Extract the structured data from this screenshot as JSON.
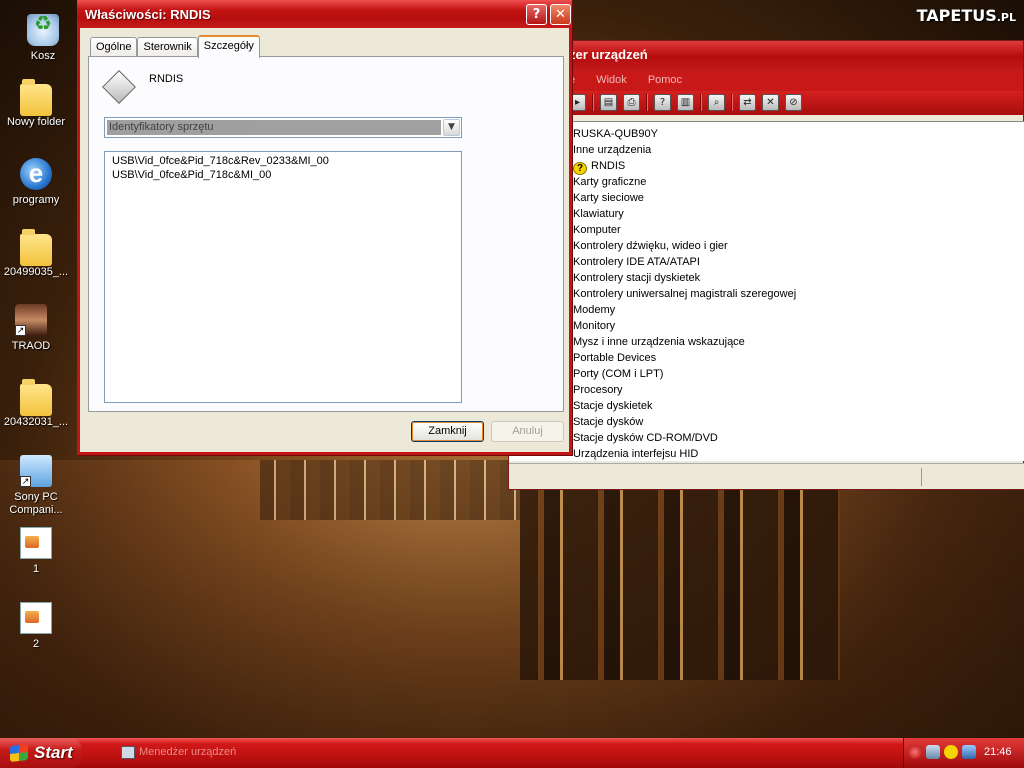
{
  "wallpaper": {
    "logo_main": "TAPETUS",
    "logo_suffix": ".PL"
  },
  "desktop_icons": [
    {
      "label": "Kosz"
    },
    {
      "label": "Nowy folder"
    },
    {
      "label": "programy"
    },
    {
      "label": "20499035_..."
    },
    {
      "label": "TRAOD"
    },
    {
      "label": "20432031_..."
    },
    {
      "label": "Sony PC Compani..."
    },
    {
      "label": "1"
    },
    {
      "label": "2"
    }
  ],
  "device_manager": {
    "title": "żer urządzeń",
    "menu": [
      "e",
      "Widok",
      "Pomoc"
    ],
    "tree": [
      "RUSKA-QUB90Y",
      "Inne urządzenia",
      "RNDIS",
      "Karty graficzne",
      "Karty sieciowe",
      "Klawiatury",
      "Komputer",
      "Kontrolery dźwięku, wideo i gier",
      "Kontrolery IDE ATA/ATAPI",
      "Kontrolery stacji dyskietek",
      "Kontrolery uniwersalnej magistrali szeregowej",
      "Modemy",
      "Monitory",
      "Mysz i inne urządzenia wskazujące",
      "Portable Devices",
      "Porty (COM i LPT)",
      "Procesory",
      "Stacje dyskietek",
      "Stacje dysków",
      "Stacje dysków CD-ROM/DVD",
      "Urządzenia interfejsu HID"
    ]
  },
  "dialog": {
    "title": "Właściwości: RNDIS",
    "help_label": "?",
    "close_label": "✕",
    "tabs": [
      "Ogólne",
      "Sterownik",
      "Szczegóły"
    ],
    "active_tab": "Szczegóły",
    "device_name": "RNDIS",
    "property_select": "Identyfikatory sprzętu",
    "values": [
      "USB\\Vid_0fce&Pid_718c&Rev_0233&MI_00",
      "USB\\Vid_0fce&Pid_718c&MI_00"
    ],
    "close_button": "Zamknij",
    "cancel_button": "Anuluj"
  },
  "taskbar": {
    "start_label": "Start",
    "task": "Menedżer urządzeń",
    "clock": "21:46"
  }
}
